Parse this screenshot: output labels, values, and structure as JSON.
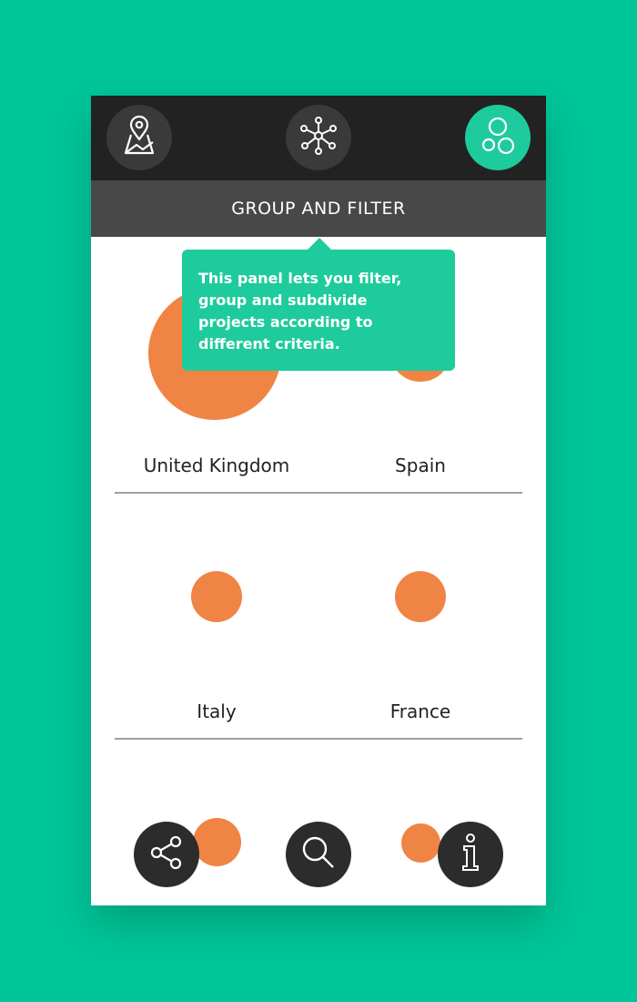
{
  "topbar": {
    "map_icon": "map-pin-icon",
    "network_icon": "network-nodes-icon",
    "group_icon": "bubbles-icon",
    "active_color": "#1ecb9c"
  },
  "header": {
    "title": "GROUP AND FILTER"
  },
  "tooltip": {
    "text": "This panel lets you filter, group and subdivide projects according to different criteria."
  },
  "groups": [
    {
      "label": "United Kingdom"
    },
    {
      "label": "Spain"
    },
    {
      "label": "Italy"
    },
    {
      "label": "France"
    }
  ],
  "bottom_actions": {
    "share_icon": "share-icon",
    "search_icon": "search-icon",
    "info_icon": "info-icon"
  },
  "colors": {
    "background": "#00c599",
    "bubble": "#f08444",
    "topbar": "#222222",
    "titlebar": "#484848"
  }
}
